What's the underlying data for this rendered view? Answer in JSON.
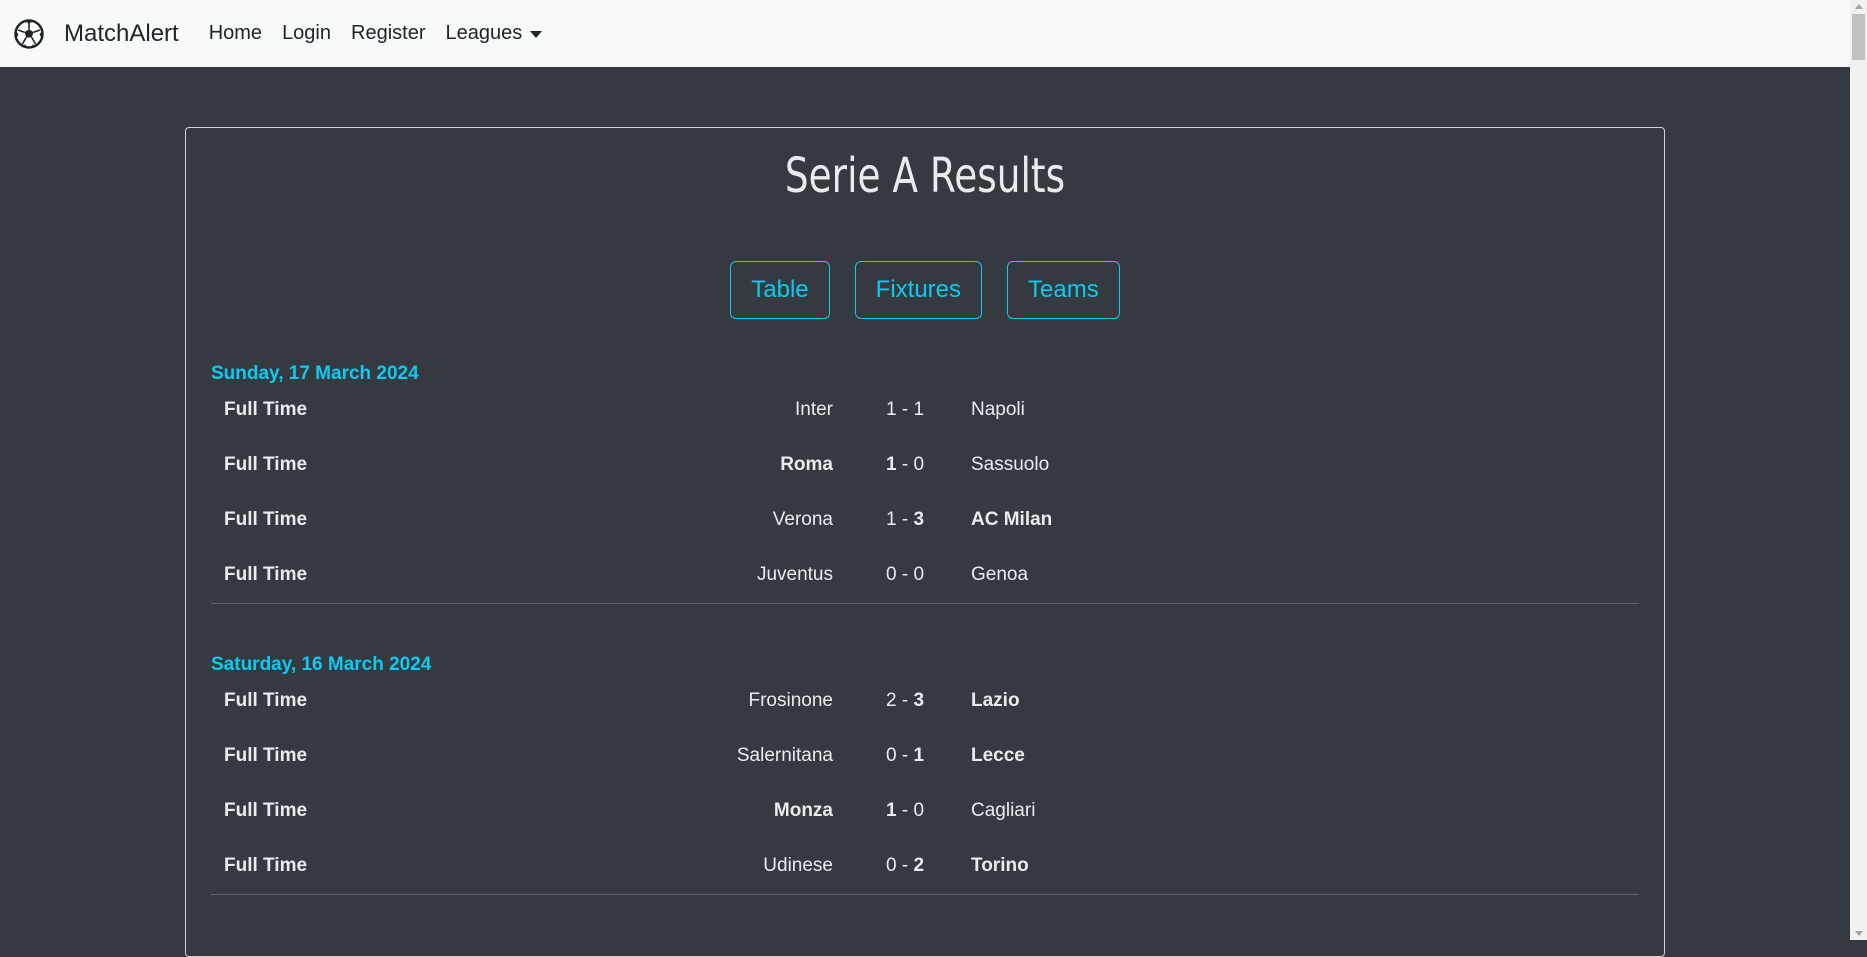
{
  "navbar": {
    "logo_icon": "soccer-ball-icon",
    "brand": "MatchAlert",
    "links": [
      "Home",
      "Login",
      "Register"
    ],
    "dropdown_label": "Leagues"
  },
  "page": {
    "title": "Serie A Results",
    "buttons": [
      "Table",
      "Fixtures",
      "Teams"
    ]
  },
  "days": [
    {
      "date": "Sunday, 17 March 2024",
      "matches": [
        {
          "status": "Full Time",
          "home": "Inter",
          "home_goals": "1",
          "away_goals": "1",
          "away": "Napoli",
          "winner": "draw"
        },
        {
          "status": "Full Time",
          "home": "Roma",
          "home_goals": "1",
          "away_goals": "0",
          "away": "Sassuolo",
          "winner": "home"
        },
        {
          "status": "Full Time",
          "home": "Verona",
          "home_goals": "1",
          "away_goals": "3",
          "away": "AC Milan",
          "winner": "away"
        },
        {
          "status": "Full Time",
          "home": "Juventus",
          "home_goals": "0",
          "away_goals": "0",
          "away": "Genoa",
          "winner": "draw"
        }
      ]
    },
    {
      "date": "Saturday, 16 March 2024",
      "matches": [
        {
          "status": "Full Time",
          "home": "Frosinone",
          "home_goals": "2",
          "away_goals": "3",
          "away": "Lazio",
          "winner": "away"
        },
        {
          "status": "Full Time",
          "home": "Salernitana",
          "home_goals": "0",
          "away_goals": "1",
          "away": "Lecce",
          "winner": "away"
        },
        {
          "status": "Full Time",
          "home": "Monza",
          "home_goals": "1",
          "away_goals": "0",
          "away": "Cagliari",
          "winner": "home"
        },
        {
          "status": "Full Time",
          "home": "Udinese",
          "home_goals": "0",
          "away_goals": "2",
          "away": "Torino",
          "winner": "away"
        }
      ]
    }
  ],
  "colors": {
    "background": "#343a40",
    "navbar": "#f8f9fa",
    "accent": "#0dcaf0",
    "text": "#e9ecef"
  }
}
